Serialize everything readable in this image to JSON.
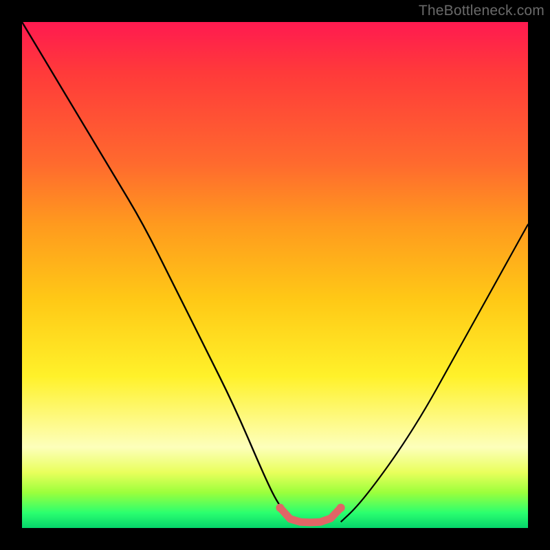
{
  "watermark": "TheBottleneck.com",
  "colors": {
    "frame": "#000000",
    "gradient_top": "#ff1a50",
    "gradient_mid1": "#ff9a1e",
    "gradient_mid2": "#fff12a",
    "gradient_bottom": "#05d46a",
    "curve": "#000000",
    "highlight": "#e06666"
  },
  "chart_data": {
    "type": "line",
    "title": "",
    "xlabel": "",
    "ylabel": "",
    "xlim": [
      0,
      100
    ],
    "ylim": [
      0,
      100
    ],
    "series": [
      {
        "name": "left-curve",
        "x": [
          0,
          6,
          12,
          18,
          24,
          30,
          36,
          42,
          48,
          51,
          54
        ],
        "y": [
          100,
          90,
          80,
          70,
          60,
          48,
          36,
          24,
          10,
          4,
          1.2
        ]
      },
      {
        "name": "right-curve",
        "x": [
          63,
          66,
          70,
          75,
          80,
          85,
          90,
          95,
          100
        ],
        "y": [
          1.2,
          4,
          9,
          16,
          24,
          33,
          42,
          51,
          60
        ]
      },
      {
        "name": "valley-highlight",
        "x": [
          51,
          53,
          55,
          57,
          59,
          61,
          63
        ],
        "y": [
          4,
          1.8,
          1.2,
          1.1,
          1.2,
          1.9,
          4
        ]
      }
    ],
    "note": "x and y are percentages of the plot-area width/height; y=0 is bottom, y=100 is top. Values are estimated from pixel positions (no axis labels present)."
  }
}
